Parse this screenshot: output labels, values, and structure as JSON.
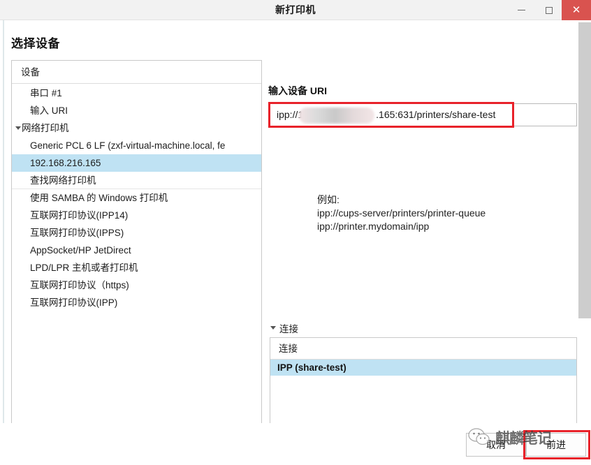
{
  "window": {
    "title": "新打印机",
    "minimize_icon": "minimize-icon",
    "maximize_icon": "maximize-icon",
    "close_icon": "close-icon",
    "close_color": "#d9534f"
  },
  "page": {
    "title": "选择设备"
  },
  "device_panel": {
    "header": "设备",
    "rows": [
      {
        "label": "串口 #1",
        "kind": "item",
        "selected": false
      },
      {
        "label": "输入 URI",
        "kind": "item",
        "selected": false
      },
      {
        "label": "网络打印机",
        "kind": "group",
        "selected": false
      },
      {
        "label": "Generic PCL 6 LF (zxf-virtual-machine.local, fe",
        "kind": "child",
        "selected": false
      },
      {
        "label": "192.168.216.165",
        "kind": "child",
        "selected": true
      },
      {
        "label": "查找网络打印机",
        "kind": "item",
        "selected": false
      },
      {
        "label": "使用 SAMBA 的 Windows 打印机",
        "kind": "item",
        "selected": false
      },
      {
        "label": "互联网打印协议(IPP14)",
        "kind": "item",
        "selected": false
      },
      {
        "label": "互联网打印协议(IPPS)",
        "kind": "item",
        "selected": false
      },
      {
        "label": "AppSocket/HP JetDirect",
        "kind": "item",
        "selected": false
      },
      {
        "label": "LPD/LPR 主机或者打印机",
        "kind": "item",
        "selected": false
      },
      {
        "label": "互联网打印协议（https)",
        "kind": "item",
        "selected": false
      },
      {
        "label": "互联网打印协议(IPP)",
        "kind": "item",
        "selected": false
      }
    ]
  },
  "uri_section": {
    "label": "输入设备 URI",
    "value_prefix": "ipp://1",
    "value_suffix": ".165:631/printers/share-test",
    "redaction": "redacted-ip-blur",
    "highlight_color": "#e8222a"
  },
  "example": {
    "text": "例如:\nipp://cups-server/printers/printer-queue\nipp://printer.mydomain/ipp"
  },
  "connection_section": {
    "section_label": "连接",
    "header": "连接",
    "rows": [
      {
        "label": "IPP (share-test)",
        "selected": true
      }
    ]
  },
  "footer": {
    "cancel_label": "取消",
    "next_label": "前进",
    "highlight_color": "#e8222a"
  },
  "watermark": {
    "text": "麒麟笔记",
    "logo_icon": "wechat-logo-icon"
  },
  "scrollbar": {
    "thumb_color": "#cdcdcd"
  }
}
